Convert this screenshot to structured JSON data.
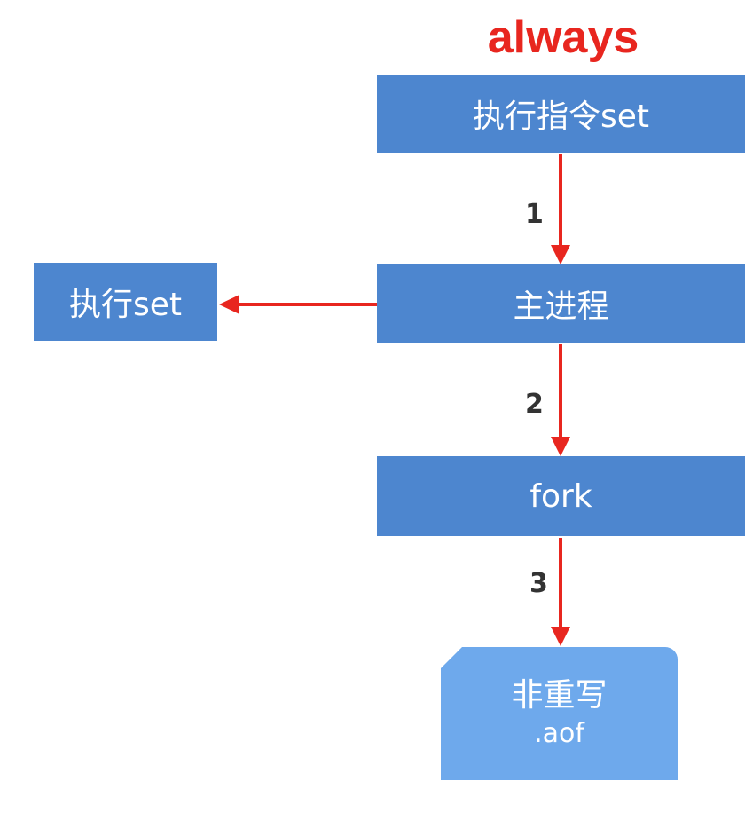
{
  "title": "always",
  "colors": {
    "title": "#e8261f",
    "box": "#4d86cf",
    "file": "#6ea9ec",
    "arrow": "#e8261f",
    "step_label": "#333333"
  },
  "nodes": {
    "command": "执行指令set",
    "main_process": "主进程",
    "execute": "执行set",
    "fork": "fork",
    "file": {
      "line1": "非重写",
      "line2": ".aof"
    }
  },
  "steps": [
    "1",
    "2",
    "3"
  ]
}
